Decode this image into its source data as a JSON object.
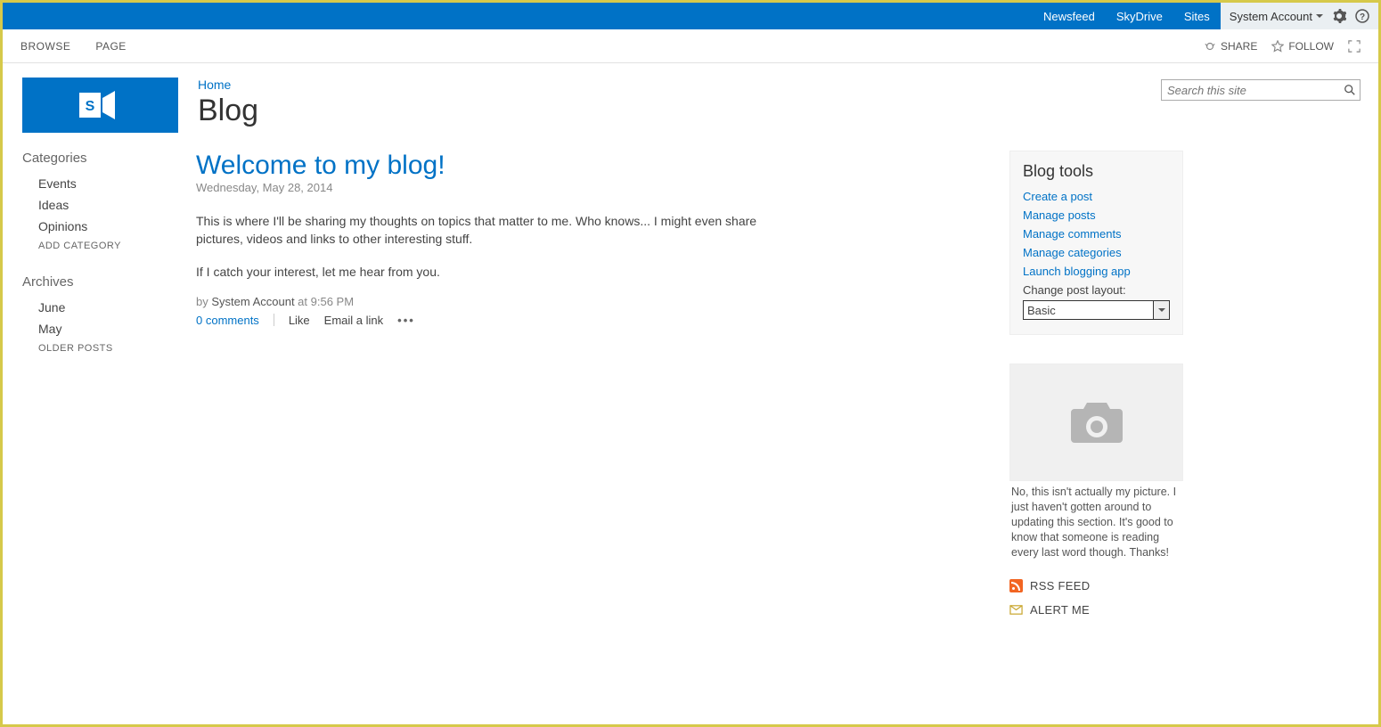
{
  "suitebar": {
    "links": [
      "Newsfeed",
      "SkyDrive",
      "Sites"
    ],
    "user": "System Account"
  },
  "ribbon": {
    "tabs": [
      "BROWSE",
      "PAGE"
    ],
    "share": "SHARE",
    "follow": "FOLLOW"
  },
  "header": {
    "breadcrumb": "Home",
    "title": "Blog",
    "search_placeholder": "Search this site"
  },
  "nav": {
    "categories_header": "Categories",
    "categories": [
      "Events",
      "Ideas",
      "Opinions"
    ],
    "add_category": "ADD CATEGORY",
    "archives_header": "Archives",
    "archives": [
      "June",
      "May"
    ],
    "older_posts": "OLDER POSTS"
  },
  "post": {
    "title": "Welcome to my blog!",
    "date": "Wednesday, May 28, 2014",
    "para1": "This is where I'll be sharing my thoughts on topics that matter to me. Who knows... I might even share pictures, videos and links to other interesting stuff.",
    "para2": "If I catch your interest, let me hear from you.",
    "by_label": "by ",
    "author": "System Account",
    "at_label": " at ",
    "time": "9:56 PM",
    "comments": "0 comments",
    "like": "Like",
    "email": "Email a link"
  },
  "tools": {
    "header": "Blog tools",
    "links": [
      "Create a post",
      "Manage posts",
      "Manage comments",
      "Manage categories",
      "Launch blogging app"
    ],
    "layout_label": "Change post layout:",
    "layout_value": "Basic"
  },
  "about": {
    "text": "No, this isn't actually my picture. I just haven't gotten around to updating this section. It's good to know that someone is reading every last word though. Thanks!"
  },
  "feeds": {
    "rss": "RSS FEED",
    "alert": "ALERT ME"
  }
}
